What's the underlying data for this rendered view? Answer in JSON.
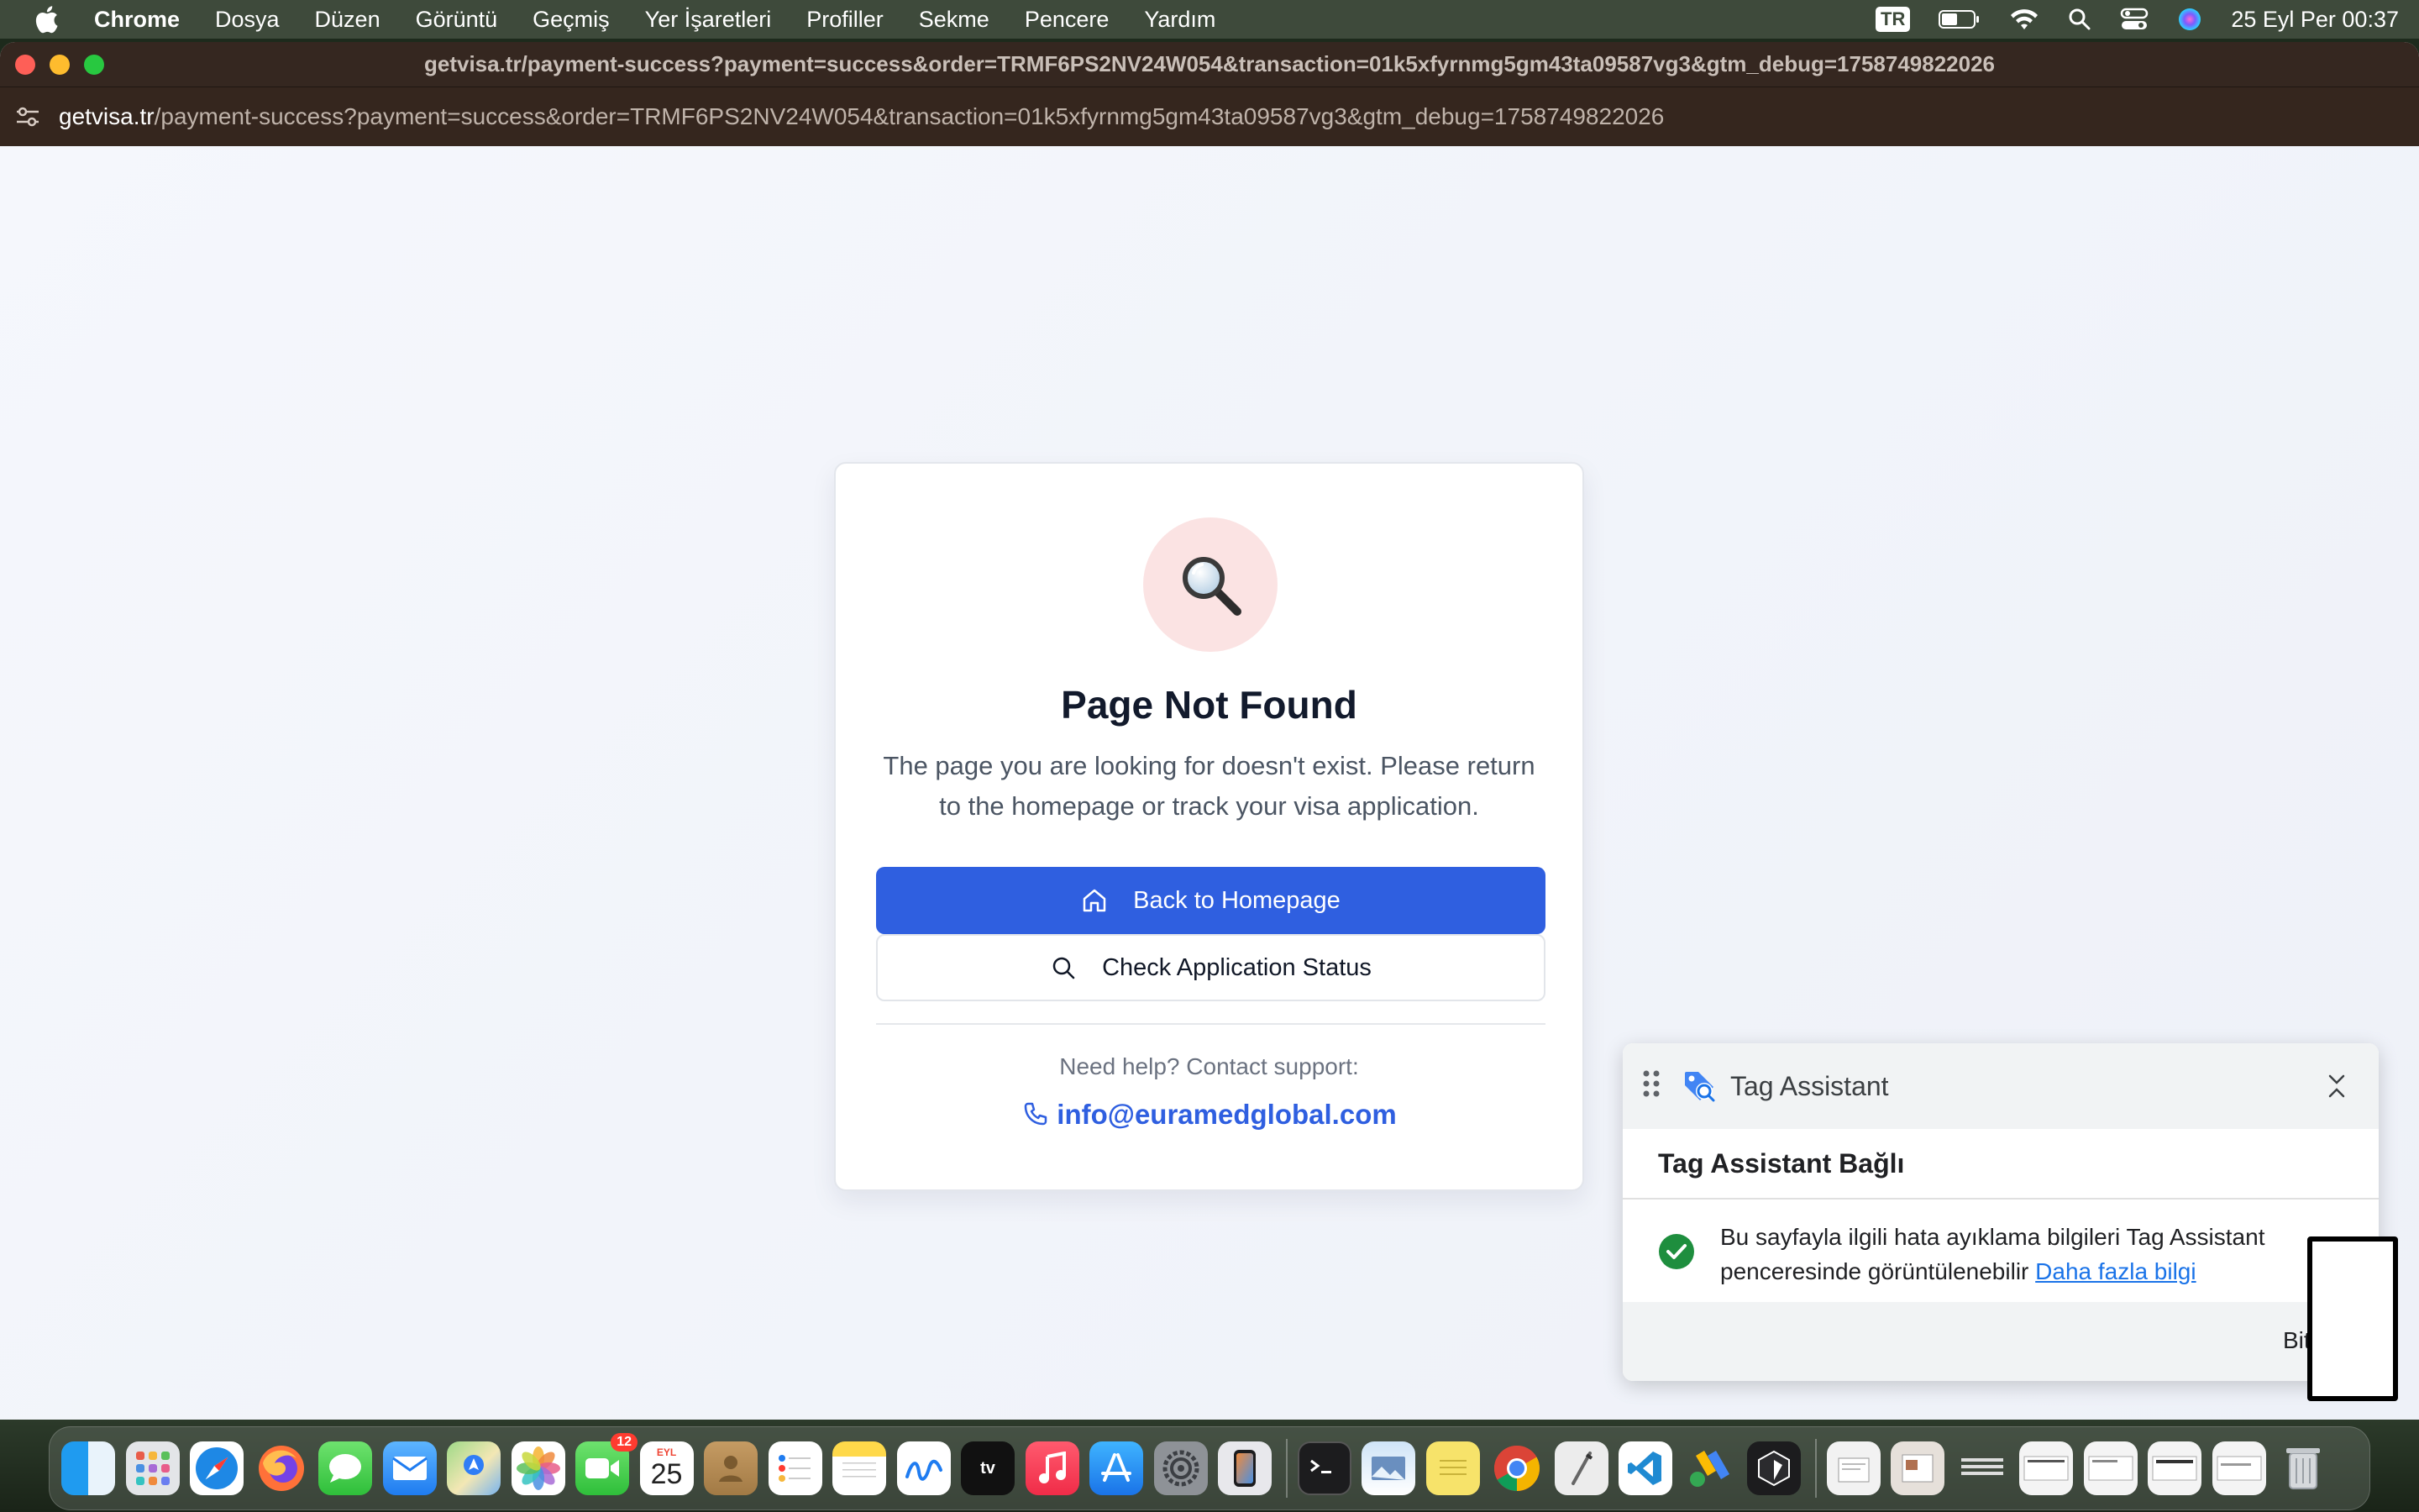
{
  "menubar": {
    "app_name": "Chrome",
    "items": [
      "Dosya",
      "Düzen",
      "Görüntü",
      "Geçmiş",
      "Yer İşaretleri",
      "Profiller",
      "Sekme",
      "Pencere",
      "Yardım"
    ],
    "input_source": "TR",
    "clock": "25 Eyl Per  00:37"
  },
  "browser": {
    "window_title": "getvisa.tr/payment-success?payment=success&order=TRMF6PS2NV24W054&transaction=01k5xfyrnmg5gm43ta09587vg3&gtm_debug=1758749822026",
    "url_host": "getvisa.tr",
    "url_path": "/payment-success?payment=success&order=TRMF6PS2NV24W054&transaction=01k5xfyrnmg5gm43ta09587vg3&gtm_debug=1758749822026"
  },
  "page": {
    "title": "Page Not Found",
    "description": "The page you are looking for doesn't exist. Please return to the homepage or track your visa application.",
    "primary_button": "Back to Homepage",
    "secondary_button": "Check Application Status",
    "help_text": "Need help? Contact support:",
    "support_email": "info@euramedglobal.com",
    "colors": {
      "primary": "#2f5fe0",
      "icon_bg": "#fbe3e3"
    }
  },
  "tag_assistant": {
    "title": "Tag Assistant",
    "status_heading": "Tag Assistant Bağlı",
    "message": "Bu sayfayla ilgili hata ayıklama bilgileri Tag Assistant penceresinde görüntülenebilir",
    "link_text": "Daha fazla bilgi",
    "done_label": "Bit"
  },
  "dock": {
    "calendar_month": "EYL",
    "calendar_day": "25",
    "facetime_badge": "12",
    "apps": [
      "finder-icon",
      "launchpad-icon",
      "safari-icon",
      "firefox-icon",
      "messages-icon",
      "mail-icon",
      "maps-icon",
      "photos-icon",
      "facetime-icon",
      "calendar-icon",
      "contacts-icon",
      "reminders-icon",
      "notes-icon",
      "freeform-icon",
      "tv-icon",
      "music-icon",
      "app-store-icon",
      "system-settings-icon",
      "iphone-mirroring-icon",
      "terminal-icon",
      "preview-icon",
      "stickies-icon",
      "chrome-icon",
      "script-editor-icon",
      "vscode-icon",
      "google-ads-icon",
      "cursor-icon"
    ],
    "tv_label": "tv"
  }
}
